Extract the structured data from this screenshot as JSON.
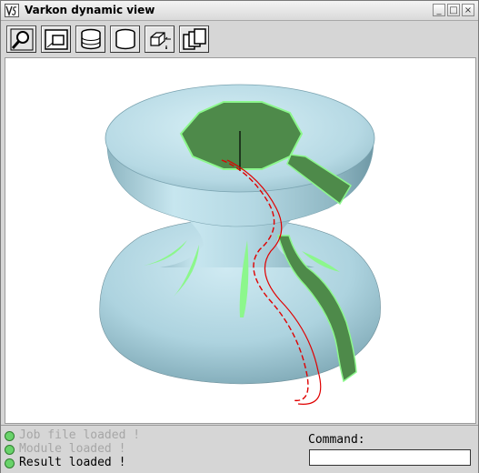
{
  "window": {
    "title": "Varkon dynamic view",
    "app_icon": "varkon-logo-icon",
    "controls": {
      "minimize": "_",
      "maximize": "□",
      "close": "×"
    }
  },
  "toolbar": {
    "buttons": [
      {
        "name": "zoom",
        "icon": "magnifier-icon"
      },
      {
        "name": "scale",
        "icon": "frame-scale-icon"
      },
      {
        "name": "perspective",
        "icon": "wireframe-cylinder-icon"
      },
      {
        "name": "shade",
        "icon": "shaded-cylinder-icon"
      },
      {
        "name": "light",
        "icon": "light-direction-icon"
      },
      {
        "name": "copy",
        "icon": "copy-pages-icon"
      }
    ]
  },
  "viewport": {
    "model": "shaded-spool-surface",
    "colors": {
      "surface": "#b6d9e4",
      "band": "#4e8a4a",
      "band_edge": "#8cf78c",
      "curve": "#e00000",
      "axis": "#000000"
    }
  },
  "status": {
    "messages": [
      {
        "text": "Job file loaded !",
        "active": false
      },
      {
        "text": "Module loaded !",
        "active": false
      },
      {
        "text": "Result loaded !",
        "active": true
      }
    ],
    "colors": {
      "inactive": "#a6a6a6",
      "active": "#000000",
      "dot": "#69d36a"
    }
  },
  "command": {
    "label": "Command:",
    "value": ""
  }
}
